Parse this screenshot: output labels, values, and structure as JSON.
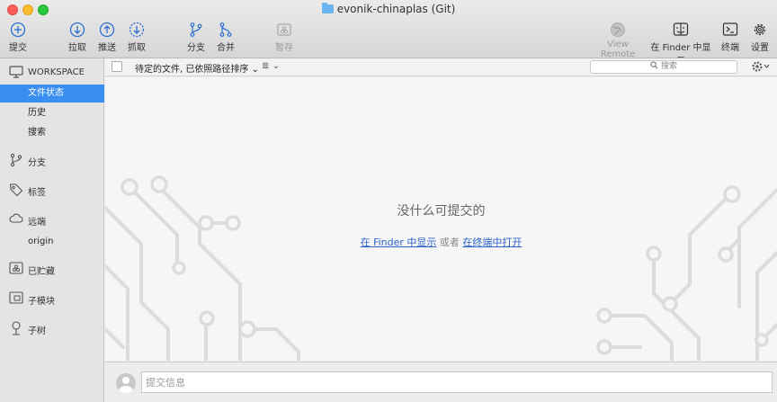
{
  "window": {
    "title": "evonik-chinaplas (Git)"
  },
  "toolbar": {
    "commit": "提交",
    "pull": "拉取",
    "push": "推送",
    "fetch": "抓取",
    "branch": "分支",
    "merge": "合并",
    "stash": "暂存",
    "view_remote": "View Remote",
    "show_in_finder": "在 Finder 中显示",
    "terminal": "终端",
    "settings": "设置"
  },
  "sidebar": {
    "workspace": {
      "header": "WORKSPACE",
      "items": [
        {
          "label": "文件状态",
          "active": true
        },
        {
          "label": "历史",
          "active": false
        },
        {
          "label": "搜索",
          "active": false
        }
      ]
    },
    "branches": "分支",
    "tags": "标签",
    "remotes": {
      "header": "远端",
      "items": [
        "origin"
      ]
    },
    "stashes": "已贮藏",
    "submodules": "子模块",
    "subtrees": "子树"
  },
  "filterbar": {
    "sort_label": "待定的文件, 已依照路径排序",
    "search_placeholder": "搜索"
  },
  "main": {
    "empty_title": "没什么可提交的",
    "show_in_finder_link": "在 Finder 中显示",
    "or": "或者",
    "open_terminal_link": "在终端中打开"
  },
  "commit": {
    "placeholder": "提交信息"
  },
  "colors": {
    "accent": "#3a8ef0",
    "link": "#2b63c7"
  }
}
